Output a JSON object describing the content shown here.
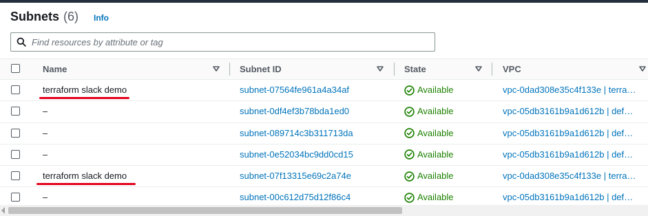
{
  "header": {
    "title": "Subnets",
    "count": "(6)",
    "info_label": "Info"
  },
  "search": {
    "placeholder": "Find resources by attribute or tag",
    "value": ""
  },
  "columns": [
    "Name",
    "Subnet ID",
    "State",
    "VPC"
  ],
  "rows": [
    {
      "name": "terraform slack demo",
      "subnet_id": "subnet-07564fe961a4a34af",
      "state": "Available",
      "vpc": "vpc-0dad308e35c4f133e | terra…",
      "highlighted": true
    },
    {
      "name": "–",
      "subnet_id": "subnet-0df4ef3b78bda1ed0",
      "state": "Available",
      "vpc": "vpc-05db3161b9a1d612b | def…",
      "highlighted": false
    },
    {
      "name": "–",
      "subnet_id": "subnet-089714c3b311713da",
      "state": "Available",
      "vpc": "vpc-05db3161b9a1d612b | def…",
      "highlighted": false
    },
    {
      "name": "–",
      "subnet_id": "subnet-0e52034bc9dd0cd15",
      "state": "Available",
      "vpc": "vpc-05db3161b9a1d612b | def…",
      "highlighted": false
    },
    {
      "name": "terraform slack demo",
      "subnet_id": "subnet-07f13315e69c2a74e",
      "state": "Available",
      "vpc": "vpc-0dad308e35c4f133e | terra…",
      "highlighted": true
    },
    {
      "name": "–",
      "subnet_id": "subnet-00c612d75d12f86c4",
      "state": "Available",
      "vpc": "vpc-05db3161b9a1d612b | def…",
      "highlighted": false
    }
  ],
  "icons": {
    "search": "search-icon",
    "sort": "caret-down-icon",
    "state": "check-circle-icon"
  },
  "colors": {
    "link": "#0073bb",
    "available": "#1d8102",
    "annotation": "#e3001b"
  }
}
